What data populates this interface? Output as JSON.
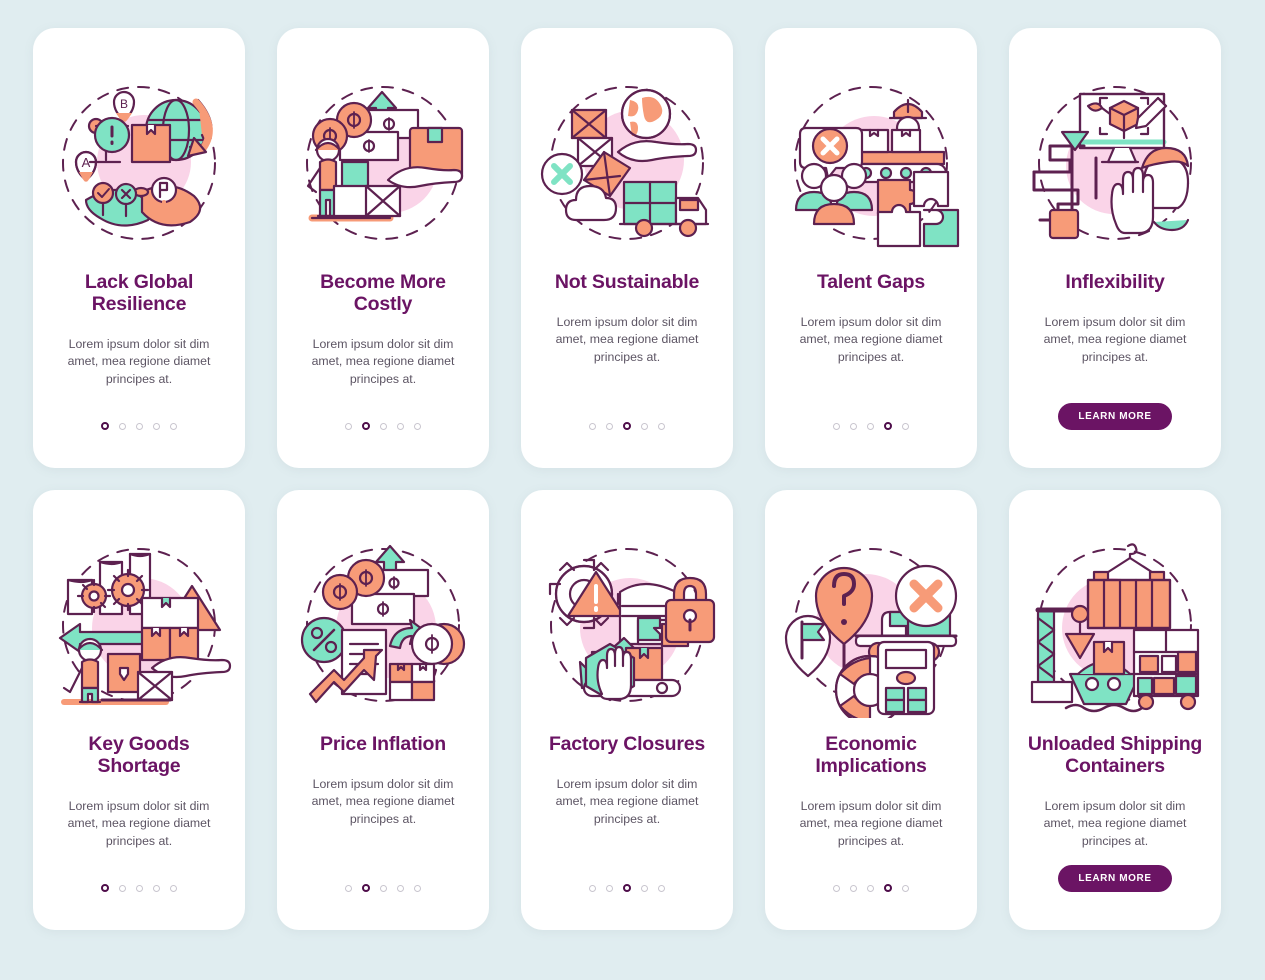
{
  "palette": {
    "background": "#e0edf0",
    "card": "#ffffff",
    "title": "#6b1464",
    "body_text": "#5c5463",
    "accent_purple": "#6b1464",
    "outline": "#5d2150",
    "coral": "#f79b78",
    "mint": "#7fe3c4",
    "pink_blob": "#fad4e8",
    "dot_inactive": "#c9c6cf",
    "dot_active": "#4e0d4a"
  },
  "shared": {
    "body_text": "Lorem ipsum dolor sit dim amet, mea regione diamet principes at.",
    "learn_more_label": "LEARN MORE"
  },
  "screens": [
    {
      "id": "lack-global-resilience",
      "title": "Lack Global Resilience",
      "body": "Lorem ipsum dolor sit dim amet, mea regione diamet principes at.",
      "dots": {
        "count": 5,
        "active_index": 0
      },
      "has_learn_more": false,
      "illustration_name": "globe-route-map-illustration"
    },
    {
      "id": "become-more-costly",
      "title": "Become More Costly",
      "body": "Lorem ipsum dolor sit dim amet, mea regione diamet principes at.",
      "dots": {
        "count": 5,
        "active_index": 1
      },
      "has_learn_more": false,
      "illustration_name": "rising-cost-worker-parcel-illustration"
    },
    {
      "id": "not-sustainable",
      "title": "Not Sustainable",
      "body": "Lorem ipsum dolor sit dim amet, mea regione diamet principes at.",
      "dots": {
        "count": 5,
        "active_index": 2
      },
      "has_learn_more": false,
      "illustration_name": "earth-truck-emissions-illustration"
    },
    {
      "id": "talent-gaps",
      "title": "Talent Gaps",
      "body": "Lorem ipsum dolor sit dim amet, mea regione diamet principes at.",
      "dots": {
        "count": 5,
        "active_index": 3
      },
      "has_learn_more": false,
      "illustration_name": "workers-conveyor-puzzle-illustration"
    },
    {
      "id": "inflexibility",
      "title": "Inflexibility",
      "body": "Lorem ipsum dolor sit dim amet, mea regione diamet principes at.",
      "dots": {
        "count": 0,
        "active_index": -1
      },
      "has_learn_more": true,
      "learn_more_label": "LEARN MORE",
      "illustration_name": "monitor-maze-stop-hand-illustration"
    },
    {
      "id": "key-goods-shortage",
      "title": "Key Goods Shortage",
      "body": "Lorem ipsum dolor sit dim amet, mea regione diamet principes at.",
      "dots": {
        "count": 5,
        "active_index": 0
      },
      "has_learn_more": false,
      "illustration_name": "factory-gears-warning-boxes-illustration"
    },
    {
      "id": "price-inflation",
      "title": "Price Inflation",
      "body": "Lorem ipsum dolor sit dim amet, mea regione diamet principes at.",
      "dots": {
        "count": 5,
        "active_index": 1
      },
      "has_learn_more": false,
      "illustration_name": "money-percent-chart-arrows-illustration"
    },
    {
      "id": "factory-closures",
      "title": "Factory Closures",
      "body": "Lorem ipsum dolor sit dim amet, mea regione diamet principes at.",
      "dots": {
        "count": 5,
        "active_index": 2
      },
      "has_learn_more": false,
      "illustration_name": "warehouse-lock-stop-hand-illustration"
    },
    {
      "id": "economic-implications",
      "title": "Economic Implications",
      "body": "Lorem ipsum dolor sit dim amet, mea regione diamet principes at.",
      "dots": {
        "count": 5,
        "active_index": 3
      },
      "has_learn_more": false,
      "illustration_name": "pin-truck-calculator-illustration"
    },
    {
      "id": "unloaded-shipping-containers",
      "title": "Unloaded Shipping Containers",
      "body": "Lorem ipsum dolor sit dim amet, mea regione diamet principes at.",
      "dots": {
        "count": 0,
        "active_index": -1
      },
      "has_learn_more": true,
      "learn_more_label": "LEARN MORE",
      "illustration_name": "crane-container-ship-illustration"
    }
  ]
}
